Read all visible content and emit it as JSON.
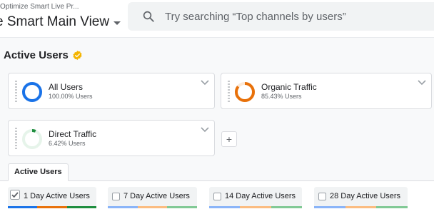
{
  "header": {
    "breadcrumb": "Optimize Smart Live Pr...",
    "view_name": "e Smart Main View",
    "search_placeholder": "Try searching “Top channels by users”"
  },
  "section": {
    "title": "Active Users",
    "verified_icon": "verified-badge-icon"
  },
  "segments": [
    {
      "name": "All Users",
      "percent": "100.00% Users",
      "fill": 1.0,
      "color": "#1a73e8"
    },
    {
      "name": "Organic Traffic",
      "percent": "85.43% Users",
      "fill": 0.8543,
      "color": "#e8710a"
    },
    {
      "name": "Direct Traffic",
      "percent": "6.42% Users",
      "fill": 0.0642,
      "color": "#1e8e3e"
    }
  ],
  "add_segment_label": "+",
  "tabs": [
    {
      "label": "Active Users",
      "active": true
    }
  ],
  "metrics": [
    {
      "label": "1 Day Active Users",
      "checked": true
    },
    {
      "label": "7 Day Active Users",
      "checked": false
    },
    {
      "label": "14 Day Active Users",
      "checked": false
    },
    {
      "label": "28 Day Active Users",
      "checked": false
    }
  ],
  "colors": {
    "all_users": "#1a73e8",
    "organic": "#e8710a",
    "direct": "#1e8e3e",
    "verified": "#f4b400"
  }
}
